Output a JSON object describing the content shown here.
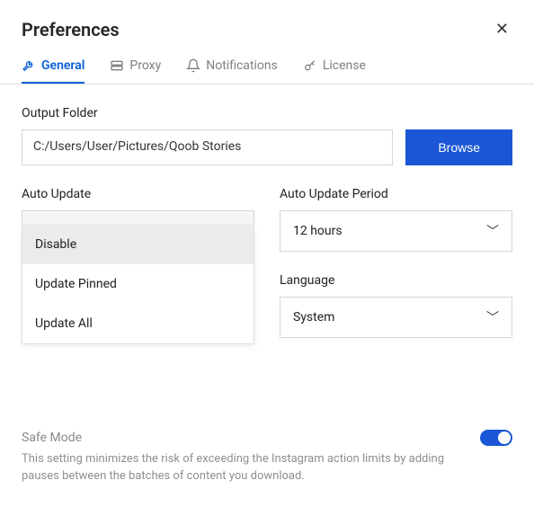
{
  "header": {
    "title": "Preferences"
  },
  "tabs": [
    {
      "label": "General",
      "active": true
    },
    {
      "label": "Proxy",
      "active": false
    },
    {
      "label": "Notifications",
      "active": false
    },
    {
      "label": "License",
      "active": false
    }
  ],
  "outputFolder": {
    "label": "Output Folder",
    "value": "C:/Users/User/Pictures/Qoob Stories",
    "browse": "Browse"
  },
  "autoUpdate": {
    "label": "Auto Update",
    "selected": "Update All",
    "options": [
      "Disable",
      "Update Pinned",
      "Update All"
    ],
    "highlighted": "Disable"
  },
  "autoUpdatePeriod": {
    "label": "Auto Update Period",
    "selected": "12 hours"
  },
  "language": {
    "label": "Language",
    "selected": "System"
  },
  "safeMode": {
    "label": "Safe Mode",
    "enabled": true,
    "help": "This setting minimizes the risk of exceeding the Instagram action limits by adding pauses between the batches of content you download."
  }
}
